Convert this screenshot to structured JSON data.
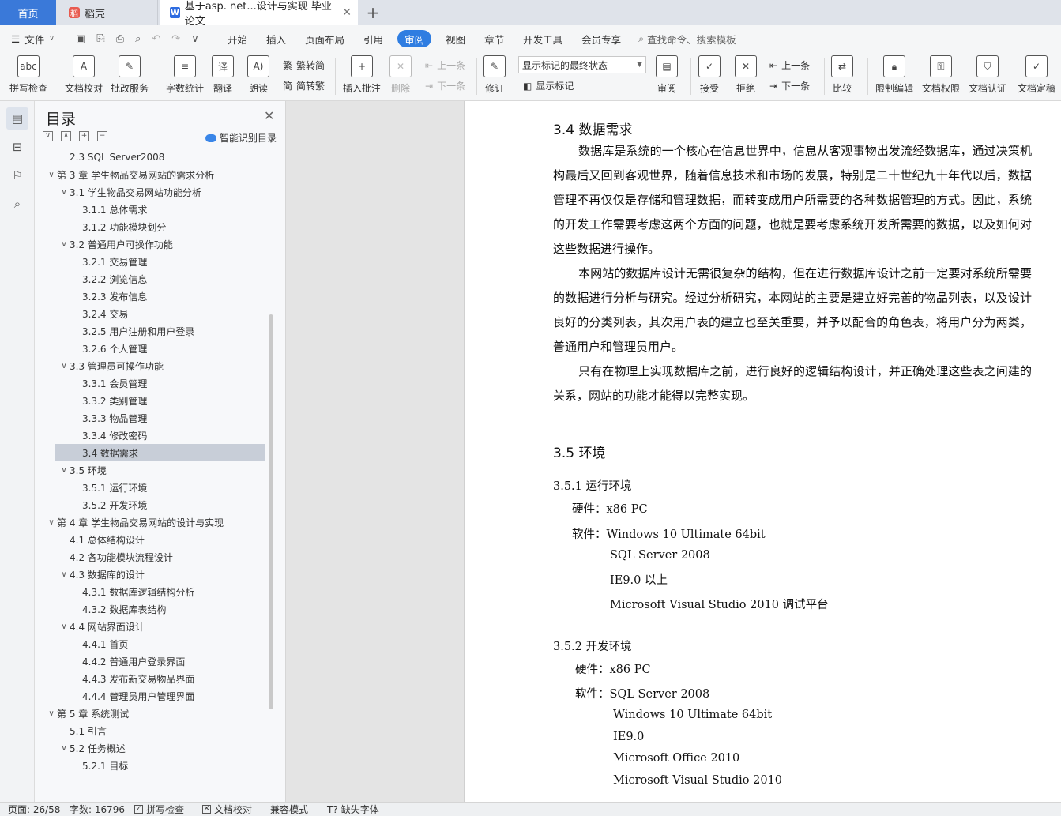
{
  "tabs": {
    "home": "首页",
    "daoke": "稻壳",
    "doc": "基于asp. net...设计与实现 毕业论文"
  },
  "menu": {
    "file": "文件",
    "items": [
      "开始",
      "插入",
      "页面布局",
      "引用",
      "审阅",
      "视图",
      "章节",
      "开发工具",
      "会员专享"
    ],
    "active": "审阅",
    "search": "查找命令、搜索模板"
  },
  "ribbon": {
    "spell": "拼写检查",
    "proof": "文档校对",
    "batch": "批改服务",
    "count": "字数统计",
    "translate": "翻译",
    "read": "朗读",
    "to_trad": "繁转简",
    "to_simp": "简转繁",
    "insert_comment": "插入批注",
    "delete": "删除",
    "prev": "上一条",
    "next": "下一条",
    "revise": "修订",
    "display_select": "显示标记的最终状态",
    "show_marks": "显示标记",
    "review": "审阅",
    "accept": "接受",
    "reject": "拒绝",
    "prev2": "上一条",
    "next2": "下一条",
    "compare": "比较",
    "restrict": "限制编辑",
    "permission": "文档权限",
    "certify": "文档认证",
    "finalize": "文档定稿"
  },
  "toc": {
    "title": "目录",
    "smart": "智能识别目录",
    "items": [
      {
        "text": "2.3 SQL Server2008",
        "level": 2,
        "chev": ""
      },
      {
        "text": "第 3 章  学生物品交易网站的需求分析",
        "level": 1,
        "chev": "v"
      },
      {
        "text": "3.1 学生物品交易网站功能分析",
        "level": 2,
        "chev": "v"
      },
      {
        "text": "3.1.1 总体需求",
        "level": 3,
        "chev": ""
      },
      {
        "text": "3.1.2 功能模块划分",
        "level": 3,
        "chev": ""
      },
      {
        "text": "3.2 普通用户可操作功能",
        "level": 2,
        "chev": "v"
      },
      {
        "text": "3.2.1 交易管理",
        "level": 3,
        "chev": ""
      },
      {
        "text": "3.2.2 浏览信息",
        "level": 3,
        "chev": ""
      },
      {
        "text": "3.2.3 发布信息",
        "level": 3,
        "chev": ""
      },
      {
        "text": "3.2.4  交易",
        "level": 3,
        "chev": ""
      },
      {
        "text": "3.2.5 用户注册和用户登录",
        "level": 3,
        "chev": ""
      },
      {
        "text": "3.2.6 个人管理",
        "level": 3,
        "chev": ""
      },
      {
        "text": "3.3 管理员可操作功能",
        "level": 2,
        "chev": "v"
      },
      {
        "text": "3.3.1 会员管理",
        "level": 3,
        "chev": ""
      },
      {
        "text": "3.3.2 类别管理",
        "level": 3,
        "chev": ""
      },
      {
        "text": "3.3.3 物品管理",
        "level": 3,
        "chev": ""
      },
      {
        "text": "3.3.4  修改密码",
        "level": 3,
        "chev": ""
      },
      {
        "text": "3.4 数据需求",
        "level": 2,
        "chev": "",
        "active": true
      },
      {
        "text": "3.5 环境",
        "level": 2,
        "chev": "v"
      },
      {
        "text": "3.5.1 运行环境",
        "level": 3,
        "chev": ""
      },
      {
        "text": "3.5.2 开发环境",
        "level": 3,
        "chev": ""
      },
      {
        "text": "第 4 章  学生物品交易网站的设计与实现",
        "level": 1,
        "chev": "v"
      },
      {
        "text": "4.1 总体结构设计",
        "level": 2,
        "chev": ""
      },
      {
        "text": "4.2 各功能模块流程设计",
        "level": 2,
        "chev": ""
      },
      {
        "text": "4.3 数据库的设计",
        "level": 2,
        "chev": "v"
      },
      {
        "text": "4.3.1 数据库逻辑结构分析",
        "level": 3,
        "chev": ""
      },
      {
        "text": "4.3.2 数据库表结构",
        "level": 3,
        "chev": ""
      },
      {
        "text": "4.4 网站界面设计",
        "level": 2,
        "chev": "v"
      },
      {
        "text": "4.4.1 首页",
        "level": 3,
        "chev": ""
      },
      {
        "text": "4.4.2 普通用户登录界面",
        "level": 3,
        "chev": ""
      },
      {
        "text": "4.4.3 发布新交易物品界面",
        "level": 3,
        "chev": ""
      },
      {
        "text": "4.4.4 管理员用户管理界面",
        "level": 3,
        "chev": ""
      },
      {
        "text": "第 5 章  系统测试",
        "level": 1,
        "chev": "v"
      },
      {
        "text": "5.1  引言",
        "level": 2,
        "chev": ""
      },
      {
        "text": "5.2  任务概述",
        "level": 2,
        "chev": "v"
      },
      {
        "text": "5.2.1  目标",
        "level": 3,
        "chev": ""
      }
    ]
  },
  "doc": {
    "h_34": "3.4 数据需求",
    "p1": "数据库是系统的一个核心在信息世界中，信息从客观事物出发流经数据库，通过决策机构最后又回到客观世界，随着信息技术和市场的发展，特别是二十世纪九十年代以后，数据管理不再仅仅是存储和管理数据，而转变成用户所需要的各种数据管理的方式。因此，系统的开发工作需要考虑这两个方面的问题，也就是要考虑系统开发所需要的数据，以及如何对这些数据进行操作。",
    "p2": "本网站的数据库设计无需很复杂的结构，但在进行数据库设计之前一定要对系统所需要的数据进行分析与研究。经过分析研究，本网站的主要是建立好完善的物品列表，以及设计良好的分类列表，其次用户表的建立也至关重要，并予以配合的角色表，将用户分为两类，普通用户和管理员用户。",
    "p3": "只有在物理上实现数据库之前，进行良好的逻辑结构设计，并正确处理这些表之间建的关系，网站的功能才能得以完整实现。",
    "h_35": "3.5 环境",
    "h_351": "3.5.1 运行环境",
    "run_hw": "硬件：x86 PC",
    "run_sw1": "软件：Windows 10 Ultimate 64bit",
    "run_sw2": "SQL Server 2008",
    "run_sw3": "IE9.0 以上",
    "run_sw4": "Microsoft Visual Studio 2010 调试平台",
    "h_352": "3.5.2 开发环境",
    "dev_hw": "硬件：x86 PC",
    "dev_sw1": "软件：SQL Server 2008",
    "dev_sw2": "Windows 10 Ultimate 64bit",
    "dev_sw3": "IE9.0",
    "dev_sw4": "Microsoft Office 2010",
    "dev_sw5": "Microsoft Visual Studio 2010"
  },
  "status": {
    "page": "页面: 26/58",
    "words": "字数: 16796",
    "spell": "拼写检查",
    "proof": "文档校对",
    "compat": "兼容模式",
    "missing_font": "缺失字体"
  },
  "colors": {
    "accent": "#2f7de1",
    "home_tab": "#3a79d9",
    "toc_active": "#c8ced8"
  }
}
